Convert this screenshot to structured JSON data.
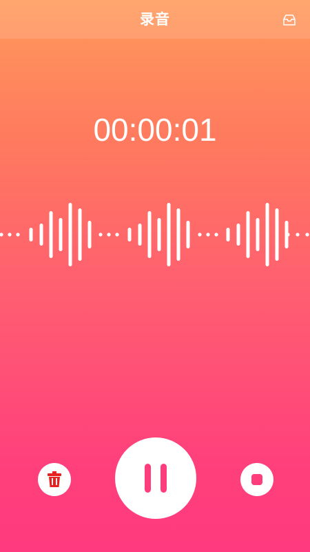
{
  "header": {
    "title": "录音",
    "inbox_icon": "inbox-tray-icon"
  },
  "recorder": {
    "elapsed_time": "00:00:01",
    "state": "recording"
  },
  "waveform": {
    "icon": "sound-wave-icon",
    "color": "#ffffff"
  },
  "controls": {
    "delete_icon": "trash-icon",
    "delete_icon_color": "#e8201f",
    "pause_icon": "pause-icon",
    "pause_icon_color": "#ff3d7d",
    "stop_icon": "stop-icon",
    "stop_icon_color": "#ff3d7d"
  },
  "colors": {
    "gradient_top": "#ff9a5c",
    "gradient_bottom": "#ff3a7e"
  }
}
